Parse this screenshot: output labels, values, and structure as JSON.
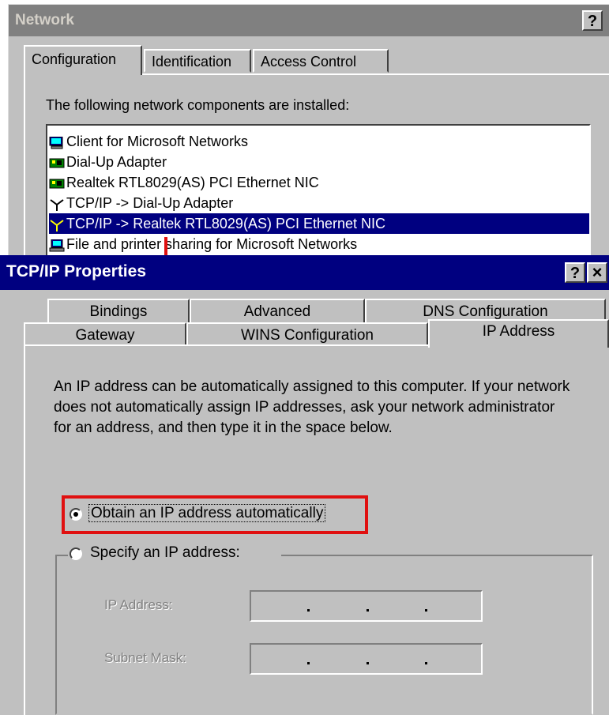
{
  "network_window": {
    "title": "Network",
    "help_glyph": "?",
    "tabs": [
      "Configuration",
      "Identification",
      "Access Control"
    ],
    "active_tab": "Configuration",
    "components_label": "The following network components are installed:",
    "components": [
      {
        "label": "Client for Microsoft Networks",
        "icon": "computer-icon"
      },
      {
        "label": "Dial-Up Adapter",
        "icon": "network-adapter-icon"
      },
      {
        "label": "Realtek RTL8029(AS) PCI Ethernet NIC",
        "icon": "network-adapter-icon"
      },
      {
        "label": "TCP/IP -> Dial-Up Adapter",
        "icon": "protocol-icon"
      },
      {
        "label": "TCP/IP -> Realtek RTL8029(AS) PCI Ethernet NIC",
        "icon": "protocol-icon",
        "selected": true
      },
      {
        "label": "File and printer sharing for Microsoft Networks",
        "icon": "file-sharing-icon"
      }
    ]
  },
  "tcpip_window": {
    "title": "TCP/IP Properties",
    "help_glyph": "?",
    "close_glyph": "×",
    "tabs_row1": [
      "Bindings",
      "Advanced",
      "DNS Configuration"
    ],
    "tabs_row2": [
      "Gateway",
      "WINS Configuration",
      "IP Address"
    ],
    "active_tab": "IP Address",
    "description": "An IP address can be automatically assigned to this computer. If your network does not automatically assign IP addresses, ask your network administrator for an address, and then type it in the space below.",
    "obtain_option": {
      "label": "Obtain an IP address automatically",
      "checked": true
    },
    "specify_option": {
      "label": "Specify an IP address:",
      "checked": false
    },
    "ip_address_label": "IP Address:",
    "subnet_mask_label": "Subnet Mask:"
  },
  "colors": {
    "dialog_face": "#c0c0c0",
    "active_title": "#000080",
    "inactive_title": "#808080",
    "highlight": "#e01010"
  }
}
